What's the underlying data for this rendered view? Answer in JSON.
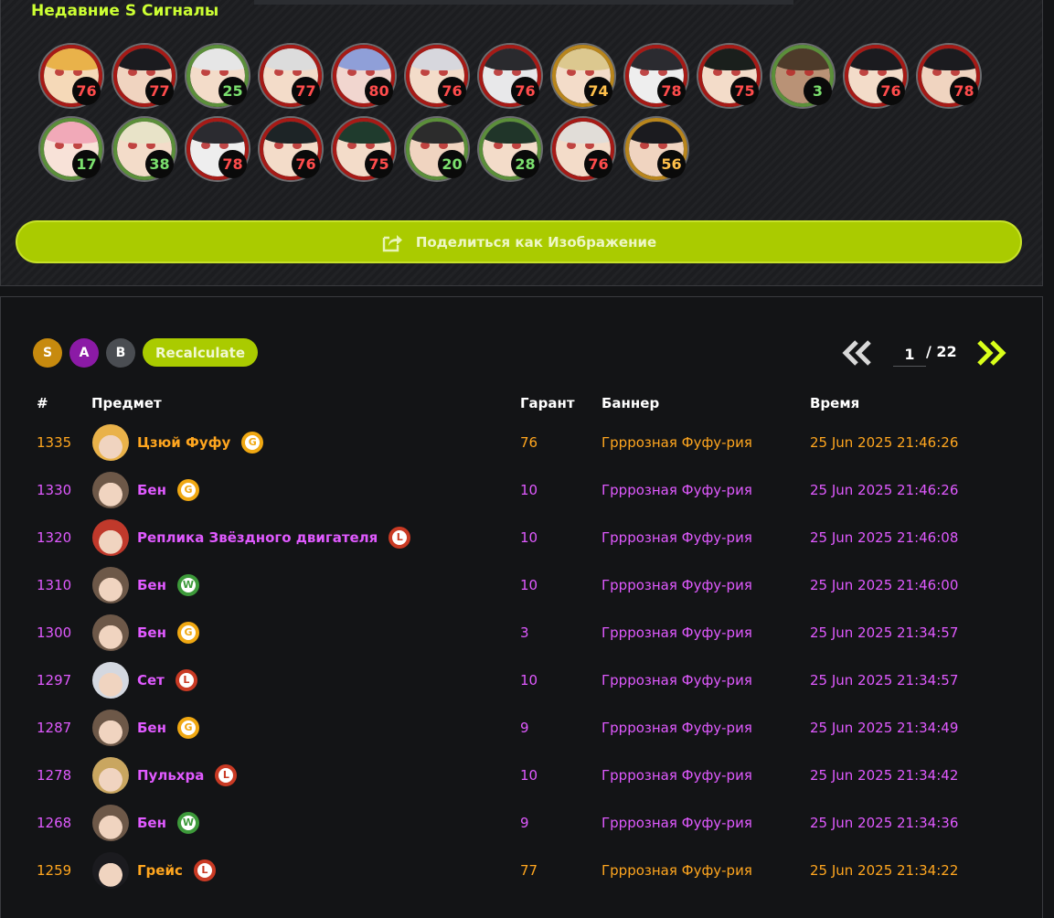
{
  "recent": {
    "title": "Недавние S Сигналы",
    "avatars": [
      {
        "value": "76",
        "ring": "red",
        "hair": "#e9b24a",
        "skin": "#f5d9b8"
      },
      {
        "value": "77",
        "ring": "red",
        "hair": "#1b1b1f",
        "skin": "#f0d4c0"
      },
      {
        "value": "25",
        "ring": "green",
        "hair": "#e6e6e6",
        "skin": "#f3dcc9"
      },
      {
        "value": "77",
        "ring": "red",
        "hair": "#dcdcdc",
        "skin": "#f3dcc9"
      },
      {
        "value": "80",
        "ring": "red",
        "hair": "#8f9fd8",
        "skin": "#f1d6cf"
      },
      {
        "value": "76",
        "ring": "red",
        "hair": "#d7d7dd",
        "skin": "#f3dcc9"
      },
      {
        "value": "76",
        "ring": "red",
        "hair": "#2a2a2e",
        "skin": "#e8e8ea"
      },
      {
        "value": "74",
        "ring": "gold",
        "hair": "#dcc88f",
        "skin": "#f3dcc9"
      },
      {
        "value": "78",
        "ring": "red",
        "hair": "#2b2b30",
        "skin": "#eeeeee"
      },
      {
        "value": "75",
        "ring": "red",
        "hair": "#1a1f1c",
        "skin": "#f3dcc9"
      },
      {
        "value": "3",
        "ring": "green",
        "hair": "#4e3b2a",
        "skin": "#b99276"
      },
      {
        "value": "76",
        "ring": "red",
        "hair": "#1b1b1f",
        "skin": "#f3dcc9"
      },
      {
        "value": "78",
        "ring": "red",
        "hair": "#1b1b1f",
        "skin": "#f0d4c0"
      },
      {
        "value": "17",
        "ring": "green",
        "hair": "#f1a9b8",
        "skin": "#f8e2d8"
      },
      {
        "value": "38",
        "ring": "green",
        "hair": "#e8e3c8",
        "skin": "#f3dcc9"
      },
      {
        "value": "78",
        "ring": "red",
        "hair": "#2b2b30",
        "skin": "#eeeeee"
      },
      {
        "value": "76",
        "ring": "red",
        "hair": "#1d2426",
        "skin": "#f3dcc9"
      },
      {
        "value": "75",
        "ring": "red",
        "hair": "#1f3b2d",
        "skin": "#f3dcc9"
      },
      {
        "value": "20",
        "ring": "green",
        "hair": "#2c2c2c",
        "skin": "#f0d4c0"
      },
      {
        "value": "28",
        "ring": "green",
        "hair": "#203529",
        "skin": "#f3dcc9"
      },
      {
        "value": "76",
        "ring": "red",
        "hair": "#e1ddd8",
        "skin": "#f3dcc9"
      },
      {
        "value": "56",
        "ring": "gold",
        "hair": "#1b1b1f",
        "skin": "#f0d4c0"
      }
    ],
    "share_label": "Поделиться как Изображение"
  },
  "filters": {
    "s": "S",
    "a": "A",
    "b": "B",
    "recalc": "Recalculate"
  },
  "pager": {
    "current": "1",
    "total": "/ 22"
  },
  "table": {
    "headers": {
      "num": "#",
      "item": "Предмет",
      "guarantee": "Гарант",
      "banner": "Баннер",
      "time": "Время"
    },
    "rows": [
      {
        "num": "1335",
        "name": "Цзюй Фуфу",
        "tag": "G",
        "guarantee": "76",
        "banner": "Грррозная Фуфу-рия",
        "time": "25 Jun 2025 21:46:26",
        "rarity": "gold",
        "avatar": "#e9b24a"
      },
      {
        "num": "1330",
        "name": "Бен",
        "tag": "G",
        "guarantee": "10",
        "banner": "Грррозная Фуфу-рия",
        "time": "25 Jun 2025 21:46:26",
        "rarity": "purple",
        "avatar": "#6d5848"
      },
      {
        "num": "1320",
        "name": "Реплика Звёздного двигателя",
        "tag": "L",
        "guarantee": "10",
        "banner": "Грррозная Фуфу-рия",
        "time": "25 Jun 2025 21:46:08",
        "rarity": "purple",
        "avatar": "#c0392b"
      },
      {
        "num": "1310",
        "name": "Бен",
        "tag": "W",
        "guarantee": "10",
        "banner": "Грррозная Фуфу-рия",
        "time": "25 Jun 2025 21:46:00",
        "rarity": "purple",
        "avatar": "#6d5848"
      },
      {
        "num": "1300",
        "name": "Бен",
        "tag": "G",
        "guarantee": "3",
        "banner": "Грррозная Фуфу-рия",
        "time": "25 Jun 2025 21:34:57",
        "rarity": "purple",
        "avatar": "#6d5848"
      },
      {
        "num": "1297",
        "name": "Сет",
        "tag": "L",
        "guarantee": "10",
        "banner": "Грррозная Фуфу-рия",
        "time": "25 Jun 2025 21:34:57",
        "rarity": "purple",
        "avatar": "#d4d8e0"
      },
      {
        "num": "1287",
        "name": "Бен",
        "tag": "G",
        "guarantee": "9",
        "banner": "Грррозная Фуфу-рия",
        "time": "25 Jun 2025 21:34:49",
        "rarity": "purple",
        "avatar": "#6d5848"
      },
      {
        "num": "1278",
        "name": "Пульхра",
        "tag": "L",
        "guarantee": "10",
        "banner": "Грррозная Фуфу-рия",
        "time": "25 Jun 2025 21:34:42",
        "rarity": "purple",
        "avatar": "#c9a660"
      },
      {
        "num": "1268",
        "name": "Бен",
        "tag": "W",
        "guarantee": "9",
        "banner": "Грррозная Фуфу-рия",
        "time": "25 Jun 2025 21:34:36",
        "rarity": "purple",
        "avatar": "#6d5848"
      },
      {
        "num": "1259",
        "name": "Грейс",
        "tag": "L",
        "guarantee": "77",
        "banner": "Грррозная Фуфу-рия",
        "time": "25 Jun 2025 21:34:22",
        "rarity": "gold",
        "avatar": "#1b1b1f"
      }
    ]
  },
  "colors": {
    "accent": "#aacb00",
    "title": "#ccff33",
    "purple": "#e05aff",
    "gold": "#ffa61f",
    "chip_s": "#c78a0e",
    "chip_a": "#8b1aa6",
    "chip_b": "#4a4d52"
  }
}
